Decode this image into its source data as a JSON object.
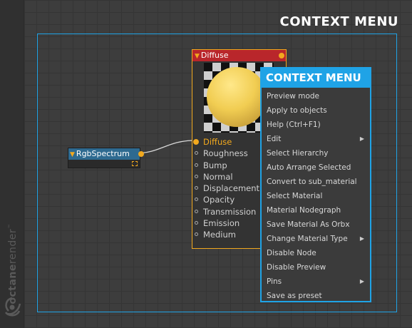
{
  "branding": {
    "brand_a": "octane",
    "brand_b": "render",
    "tm": "™"
  },
  "header": {
    "title": "CONTEXT MENU"
  },
  "rgb_node": {
    "title": "RgbSpectrum",
    "collapse_icon": "triangle-down-icon"
  },
  "material_node": {
    "title": "Diffuse",
    "pins": [
      "Diffuse",
      "Roughness",
      "Bump",
      "Normal",
      "Displacement",
      "Opacity",
      "Transmission",
      "Emission",
      "Medium"
    ]
  },
  "context_menu": {
    "title": "CONTEXT MENU",
    "items": [
      {
        "label": "Preview mode",
        "submenu": false
      },
      {
        "label": "Apply to objects",
        "submenu": false
      },
      {
        "label": "Help (Ctrl+F1)",
        "submenu": false
      },
      {
        "label": "Edit",
        "submenu": true
      },
      {
        "label": "Select Hierarchy",
        "submenu": false
      },
      {
        "label": "Auto Arrange Selected",
        "submenu": false
      },
      {
        "label": "Convert to sub_material",
        "submenu": false
      },
      {
        "label": "Select Material",
        "submenu": false
      },
      {
        "label": "Material Nodegraph",
        "submenu": false
      },
      {
        "label": "Save Material As Orbx",
        "submenu": false
      },
      {
        "label": "Change Material Type",
        "submenu": true
      },
      {
        "label": "Disable Node",
        "submenu": false
      },
      {
        "label": "Disable Preview",
        "submenu": false
      },
      {
        "label": "Pins",
        "submenu": true
      },
      {
        "label": "Save as preset",
        "submenu": false
      }
    ]
  },
  "colors": {
    "accent": "#1fa3e6",
    "pin_active": "#f2a91e",
    "material_header": "#b9262b",
    "texture_header": "#2e6a90"
  }
}
